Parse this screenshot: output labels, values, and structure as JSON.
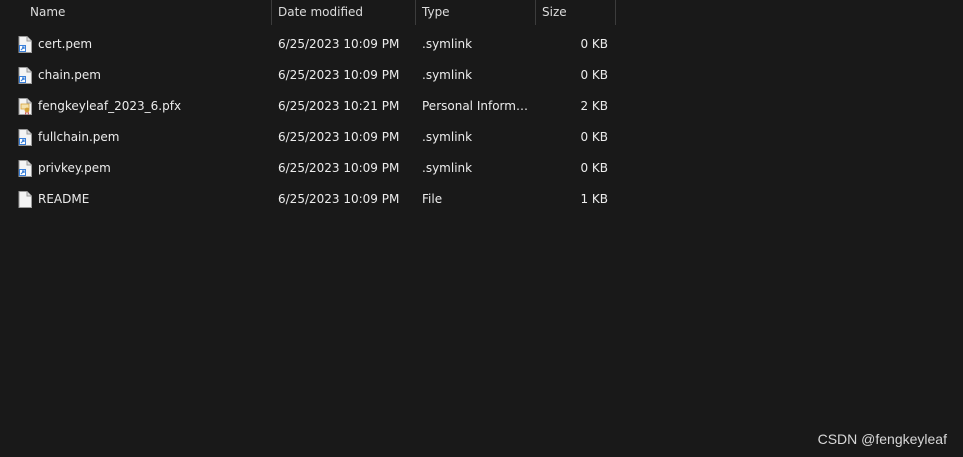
{
  "header": {
    "name_label": "Name",
    "date_label": "Date modified",
    "type_label": "Type",
    "size_label": "Size",
    "sort_indicator": "^"
  },
  "files": [
    {
      "name": "cert.pem",
      "date": "6/25/2023 10:09 PM",
      "type": ".symlink",
      "size": "0 KB",
      "icon": "symlink-file-icon"
    },
    {
      "name": "chain.pem",
      "date": "6/25/2023 10:09 PM",
      "type": ".symlink",
      "size": "0 KB",
      "icon": "symlink-file-icon"
    },
    {
      "name": "fengkeyleaf_2023_6.pfx",
      "date": "6/25/2023 10:21 PM",
      "type": "Personal Informati...",
      "size": "2 KB",
      "icon": "certificate-file-icon"
    },
    {
      "name": "fullchain.pem",
      "date": "6/25/2023 10:09 PM",
      "type": ".symlink",
      "size": "0 KB",
      "icon": "symlink-file-icon"
    },
    {
      "name": "privkey.pem",
      "date": "6/25/2023 10:09 PM",
      "type": ".symlink",
      "size": "0 KB",
      "icon": "symlink-file-icon"
    },
    {
      "name": "README",
      "date": "6/25/2023 10:09 PM",
      "type": "File",
      "size": "1 KB",
      "icon": "generic-file-icon"
    }
  ],
  "watermark": "CSDN @fengkeyleaf",
  "colors": {
    "background": "#191919",
    "text": "#ececec",
    "header_text": "#dcdcdc",
    "divider": "#3c3c3c",
    "symlink_arrow": "#3a7fd8",
    "certificate_accent": "#d6a23a"
  }
}
